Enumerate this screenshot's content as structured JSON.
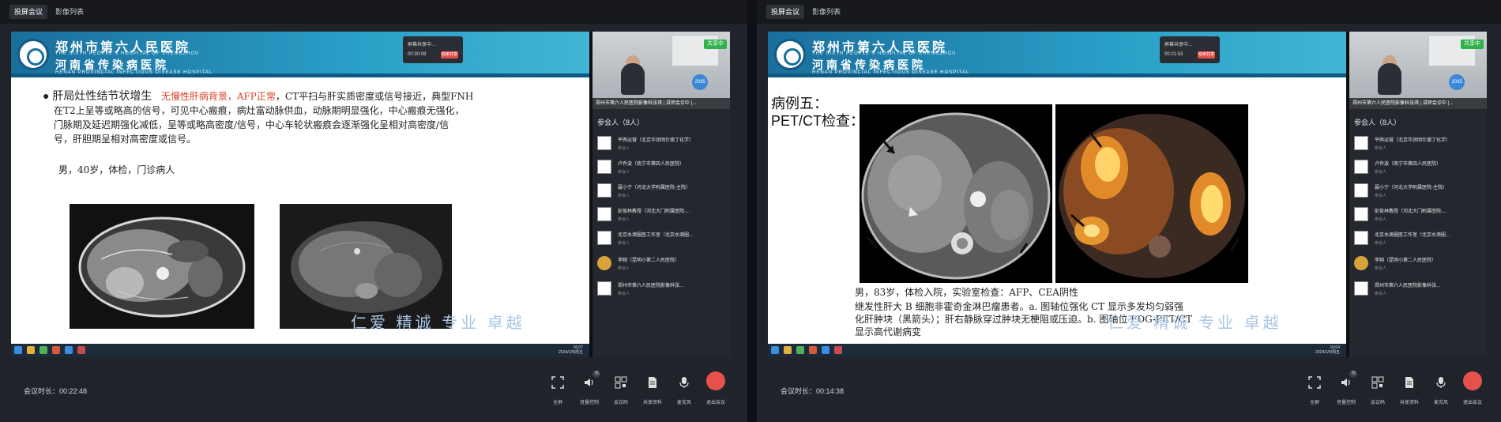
{
  "tabs": [
    "投屏会议",
    "影像列表"
  ],
  "slide_header": {
    "hospital1": "郑州市第六人民医院",
    "hospital1_en": "THE SIXTH PEOPLE'S HOSPITAL OF ZHENGZHOU",
    "hospital2": "河南省传染病医院",
    "hospital2_en": "HENAN PROVINCIAL INFECTIOUS DISEASE HOSPITAL"
  },
  "left": {
    "timer": {
      "title": "屏幕共享中...",
      "time": "00:30:09",
      "end": "结束共享"
    },
    "bullet_title": "肝局灶性结节状增生",
    "bullet_red": "无慢性肝病背景，AFP正常",
    "bullet_body1": "，CT平扫与肝实质密度或信号接近，典型FNH",
    "bullet_body2": "在T2上呈等或略高的信号，可见中心瘢痕，病灶富动脉供血，动脉期明显强化，中心瘢痕无强化，",
    "bullet_body3": "门脉期及延迟期强化减低，呈等或略高密度/信号，中心车轮状瘢痕会逐渐强化呈相对高密度/信",
    "bullet_body4": "号，肝胆期呈相对高密度或信号。",
    "patient": "男，40岁，体检，门诊病人",
    "motto": "仁爱  精诚  专业  卓越",
    "duration": "会议时长：00:22:48",
    "taskbar_time": "16:07\n2024/1/5/周五"
  },
  "right": {
    "timer": {
      "title": "屏幕共享中...",
      "time": "00:21:53",
      "end": "结束共享"
    },
    "case_title": "病例五：",
    "case_sub": "PET/CT检查：",
    "patient": "男，83岁，体检入院，实验室检查：AFP、CEA阴性",
    "desc1": "继发性肝大 B 细胞非霍奇金淋巴瘤患者。a. 图轴位强化 CT 显示多发均匀弱强",
    "desc2": "化肝肿块（黑箭头）；肝右静脉穿过肿块无梗阻或压迫。b. 图轴位 FDG-PET/CT",
    "desc3": "显示高代谢病变",
    "motto": "仁爱  精诚  专业  卓越",
    "duration": "会议时长：00:14:38",
    "taskbar_time": "16:04\n2024/1/5/周五"
  },
  "sidebar": {
    "share": "共享中",
    "video_caption": "郑州市第六人民医院影像科张琪 | 讲师会诊中 (...",
    "participants_title": "参会人（8人）",
    "participants": [
      {
        "name": "平舆运营（北京华润明仕德丁化学）",
        "role": "参会人"
      },
      {
        "name": "卢乔波（南宁市第四人民医院）",
        "role": "参会人"
      },
      {
        "name": "聂小宁（河北大学附属医院-主院）",
        "role": "参会人"
      },
      {
        "name": "彭俊林教授（河北大门附属医院-...",
        "role": "参会人"
      },
      {
        "name": "北京水滴圈医工作室（北京水滴圈...",
        "role": "参会人"
      },
      {
        "name": "李翔（昆明小第二人民医院）",
        "role": "参会人"
      },
      {
        "name": "郑州市第六人民医院影像科张...",
        "role": "参会人"
      }
    ],
    "avatar_badge": "2035"
  },
  "controls": [
    {
      "label": "全屏",
      "icon": "fullscreen-icon"
    },
    {
      "label": "音量控制",
      "icon": "speaker-icon",
      "badge": "75"
    },
    {
      "label": "会议码",
      "icon": "qr-icon"
    },
    {
      "label": "共享资料",
      "icon": "document-icon"
    },
    {
      "label": "麦克风",
      "icon": "microphone-icon"
    },
    {
      "label": "退出会议",
      "icon": "hangup-icon"
    }
  ]
}
